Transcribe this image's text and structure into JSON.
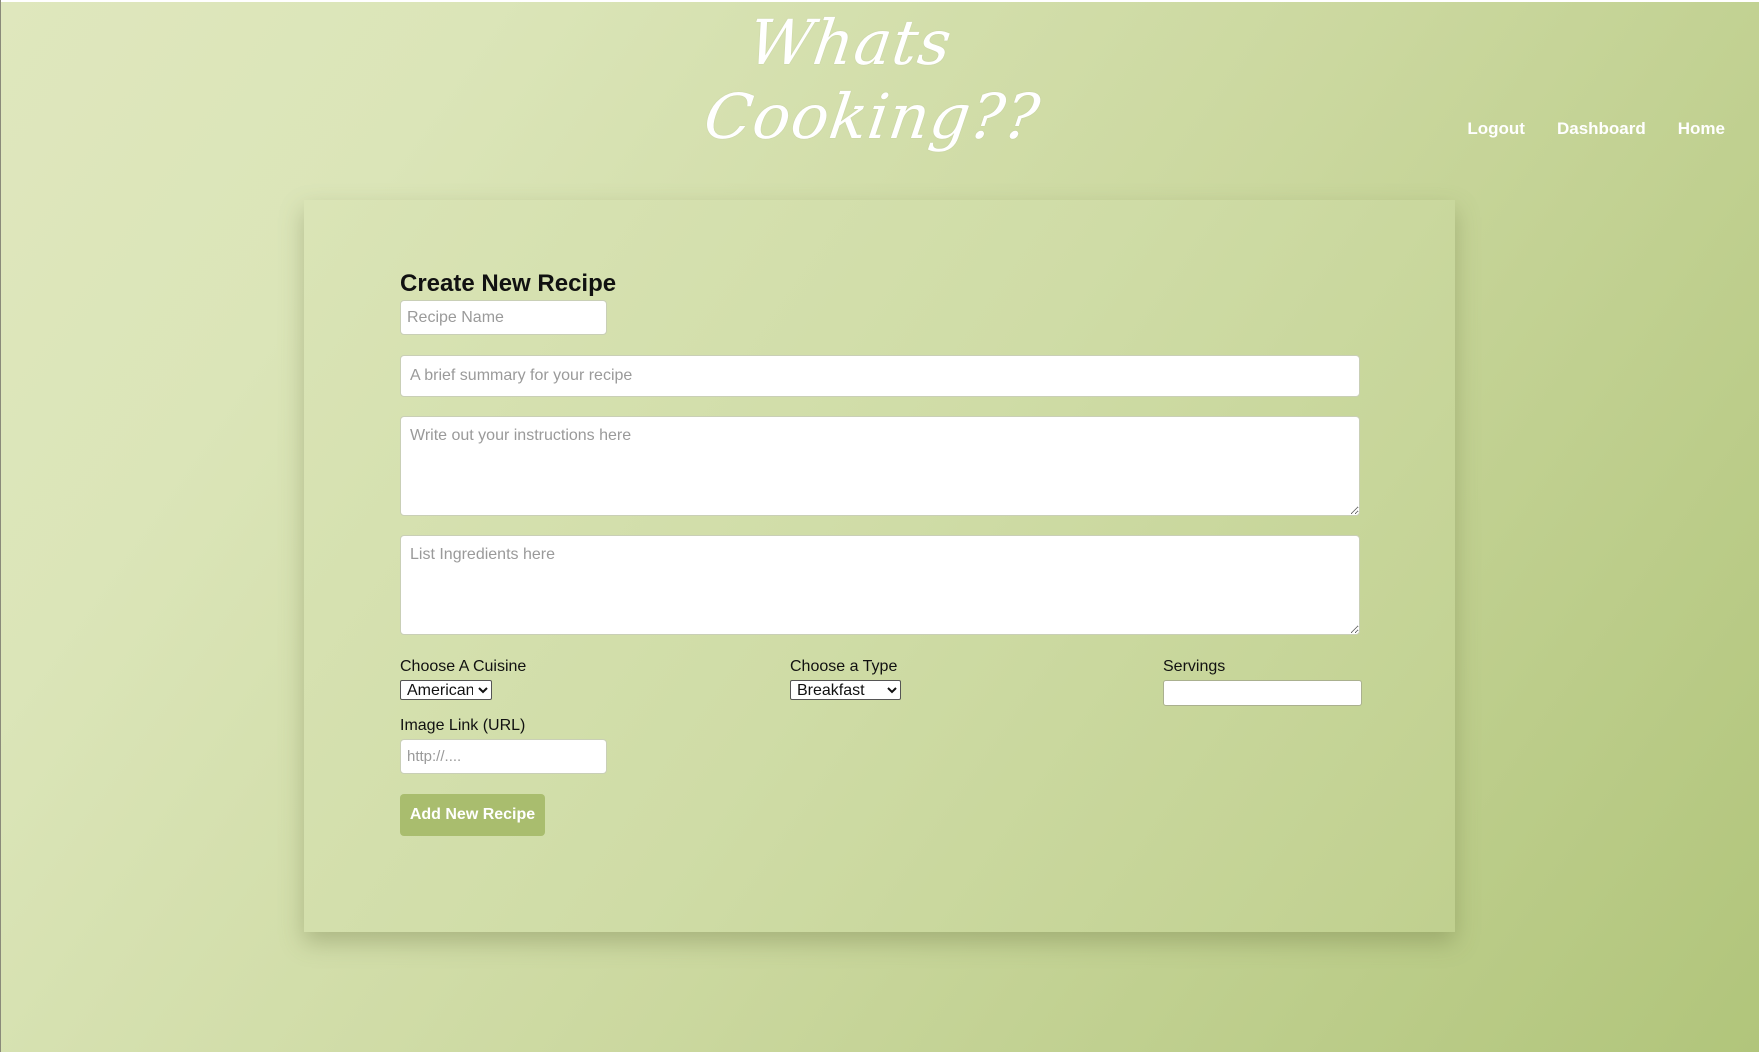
{
  "header": {
    "logo_line1": "Whats",
    "logo_line2": "Cooking??",
    "nav": {
      "logout": "Logout",
      "dashboard": "Dashboard",
      "home": "Home"
    }
  },
  "form": {
    "title": "Create New Recipe",
    "recipe_name_placeholder": "Recipe Name",
    "summary_placeholder": "A brief summary for your recipe",
    "instructions_placeholder": "Write out your instructions here",
    "ingredients_placeholder": "List Ingredients here",
    "cuisine_label": "Choose A Cuisine",
    "cuisine_selected": "American",
    "type_label": "Choose a Type",
    "type_selected": "Breakfast",
    "servings_label": "Servings",
    "servings_value": "",
    "image_label": "Image Link (URL)",
    "image_placeholder": "http://....",
    "submit_label": "Add New Recipe"
  },
  "colors": {
    "accent": "#a9bd6e",
    "background_start": "#dfe7bd",
    "background_end": "#b1c57b"
  }
}
